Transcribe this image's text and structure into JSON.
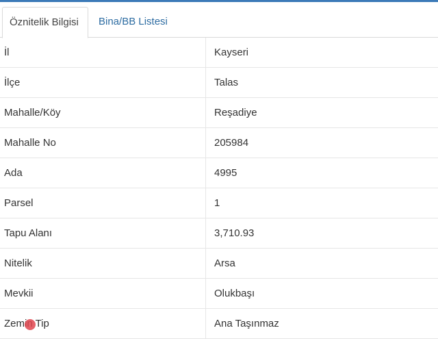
{
  "tabs": [
    {
      "label": "Öznitelik Bilgisi"
    },
    {
      "label": "Bina/BB Listesi"
    }
  ],
  "attributes": [
    {
      "label": "İl",
      "value": "Kayseri"
    },
    {
      "label": "İlçe",
      "value": "Talas"
    },
    {
      "label": "Mahalle/Köy",
      "value": "Reşadiye"
    },
    {
      "label": "Mahalle No",
      "value": "205984"
    },
    {
      "label": "Ada",
      "value": "4995"
    },
    {
      "label": "Parsel",
      "value": "1"
    },
    {
      "label": "Tapu Alanı",
      "value": "3,710.93"
    },
    {
      "label": "Nitelik",
      "value": "Arsa"
    },
    {
      "label": "Mevkii",
      "value": "Olukbaşı"
    },
    {
      "label": "Zemin Tip",
      "value": "Ana Taşınmaz"
    }
  ],
  "colors": {
    "accent": "#3c7ab8",
    "link": "#2d6ca2",
    "border": "#e6e6e6",
    "cursor": "#e0454f"
  }
}
